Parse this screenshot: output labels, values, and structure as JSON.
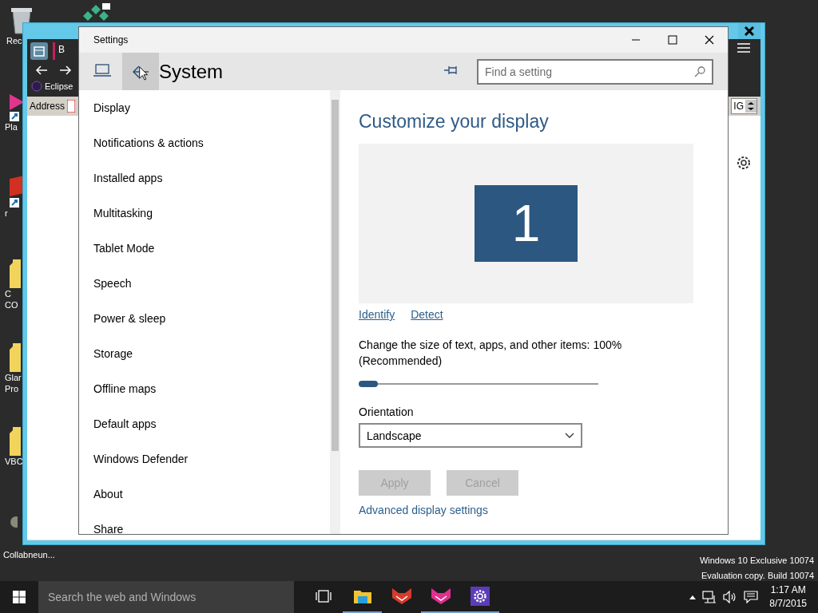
{
  "desktop": {
    "icons": [
      {
        "kind": "recycle-bin",
        "label": [
          "Rec"
        ]
      },
      {
        "kind": "pink-shortcut",
        "label": [
          "Pla"
        ]
      },
      {
        "kind": "red-shortcut",
        "label": [
          "r"
        ]
      },
      {
        "kind": "folder",
        "label": [
          "C",
          "CO"
        ]
      },
      {
        "kind": "folder",
        "label": [
          "Glar",
          "Pro"
        ]
      },
      {
        "kind": "folder",
        "label": [
          "VBC"
        ]
      },
      {
        "kind": "app",
        "label": [
          "Collabneun..."
        ]
      }
    ],
    "watermark": [
      "Windows 10 Exclusive 10074",
      "Evaluation copy. Build 10074"
    ]
  },
  "background_window": {
    "tab": "B",
    "bookmark": "Eclipse",
    "address_label": "Address",
    "field_value": "IG"
  },
  "settings": {
    "title": "Settings",
    "heading": "System",
    "search": {
      "placeholder": "Find a setting"
    },
    "nav_items": [
      {
        "label": "Display",
        "selected": false
      },
      {
        "label": "Notifications & actions",
        "selected": false
      },
      {
        "label": "Installed apps",
        "selected": false
      },
      {
        "label": "Multitasking",
        "selected": false
      },
      {
        "label": "Tablet Mode",
        "selected": false
      },
      {
        "label": "Speech",
        "selected": false
      },
      {
        "label": "Power & sleep",
        "selected": false
      },
      {
        "label": "Storage",
        "selected": false
      },
      {
        "label": "Offline maps",
        "selected": false
      },
      {
        "label": "Default apps",
        "selected": false
      },
      {
        "label": "Windows Defender",
        "selected": false
      },
      {
        "label": "About",
        "selected": false
      },
      {
        "label": "Share",
        "selected": false
      }
    ],
    "content": {
      "heading": "Customize your display",
      "monitor": "1",
      "links": [
        "Identify",
        "Detect"
      ],
      "scale_label": "Change the size of text, apps, and other items: 100% (Recommended)",
      "scale": {
        "level": 0
      },
      "orientation_label": "Orientation",
      "orientation": "Landscape",
      "buttons": [
        {
          "label": "Apply",
          "disabled": true
        },
        {
          "label": "Cancel",
          "disabled": true
        }
      ],
      "advanced_link": "Advanced display settings"
    }
  },
  "taskbar": {
    "search_placeholder": "Search the web and Windows",
    "apps": [
      {
        "kind": "task-view",
        "running": false
      },
      {
        "kind": "explorer",
        "running": true
      },
      {
        "kind": "red-fox",
        "running": false
      },
      {
        "kind": "pink-fox",
        "running": true
      },
      {
        "kind": "settings",
        "running": true
      }
    ],
    "time": "1:17 AM",
    "date": "8/7/2015"
  }
}
